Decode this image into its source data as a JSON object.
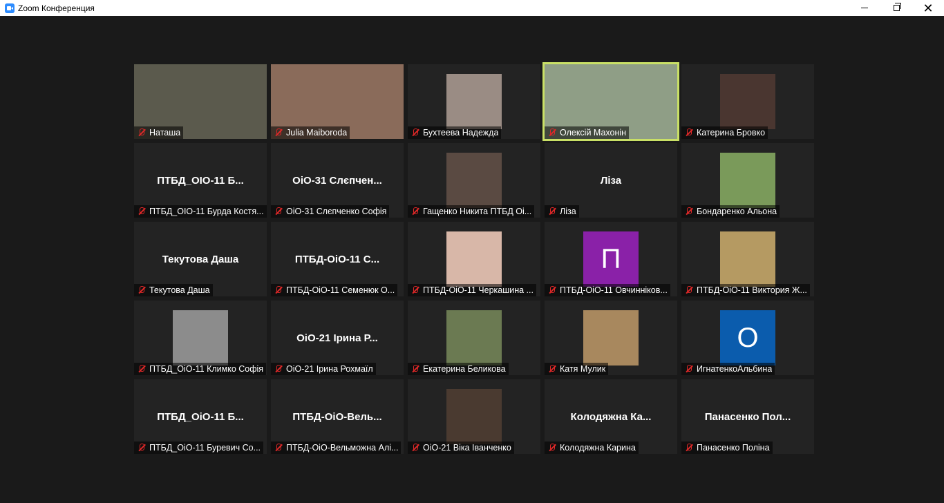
{
  "window": {
    "title": "Zoom Конференция",
    "controls": [
      "minimize",
      "restore",
      "close"
    ]
  },
  "colors": {
    "background": "#1a1a1a",
    "tile_bg": "#232323",
    "active_speaker_border": "#c9e066",
    "mute_icon": "#e02828",
    "avatar_purple": "#8a21a8",
    "avatar_blue": "#0b5cad"
  },
  "participants": [
    {
      "label": "Наташа",
      "center": ""
    },
    {
      "label": "Julia Maiboroda",
      "center": ""
    },
    {
      "label": "Бухтеева Надежда",
      "center": ""
    },
    {
      "label": "Олексій Махонін",
      "center": "",
      "active": true
    },
    {
      "label": "Катерина Бровко",
      "center": ""
    },
    {
      "label": "ПТБД_ОІО-11 Бурда Костя...",
      "center": "ПТБД_ОІО-11 Б..."
    },
    {
      "label": "ОіО-31 Слєпченко Софія",
      "center": "ОіО-31 Слєпчен..."
    },
    {
      "label": "Гащенко Никита ПТБД Оі...",
      "center": ""
    },
    {
      "label": "Ліза",
      "center": "Ліза"
    },
    {
      "label": "Бондаренко Альона",
      "center": ""
    },
    {
      "label": "Текутова Даша",
      "center": "Текутова Даша"
    },
    {
      "label": "ПТБД-ОіО-11 Семенюк О...",
      "center": "ПТБД-ОіО-11 С..."
    },
    {
      "label": "ПТБД-ОіО-11 Черкашина ...",
      "center": ""
    },
    {
      "label": "ПТБД-ОіО-11 Овчинніков...",
      "center": "",
      "avatar": "П"
    },
    {
      "label": "ПТБД-ОіО-11 Виктория Ж...",
      "center": ""
    },
    {
      "label": "ПТБД_ОіО-11 Климко Софія",
      "center": ""
    },
    {
      "label": "ОіО-21 Ірина Рохмаїл",
      "center": "ОіО-21 Ірина Р..."
    },
    {
      "label": "Екатерина Беликова",
      "center": ""
    },
    {
      "label": "Катя Мулик",
      "center": ""
    },
    {
      "label": "ИгнатенкоАльбина",
      "center": "",
      "avatar": "О"
    },
    {
      "label": "ПТБД_ОіО-11 Буревич Со...",
      "center": "ПТБД_ОіО-11 Б..."
    },
    {
      "label": "ПТБД-ОіО-Вельможна Алі...",
      "center": "ПТБД-ОіО-Вель..."
    },
    {
      "label": "ОіО-21 Віка Іванченко",
      "center": ""
    },
    {
      "label": "Колодяжна Карина",
      "center": "Колодяжна Ка..."
    },
    {
      "label": "Панасенко Поліна",
      "center": "Панасенко Пол..."
    }
  ]
}
